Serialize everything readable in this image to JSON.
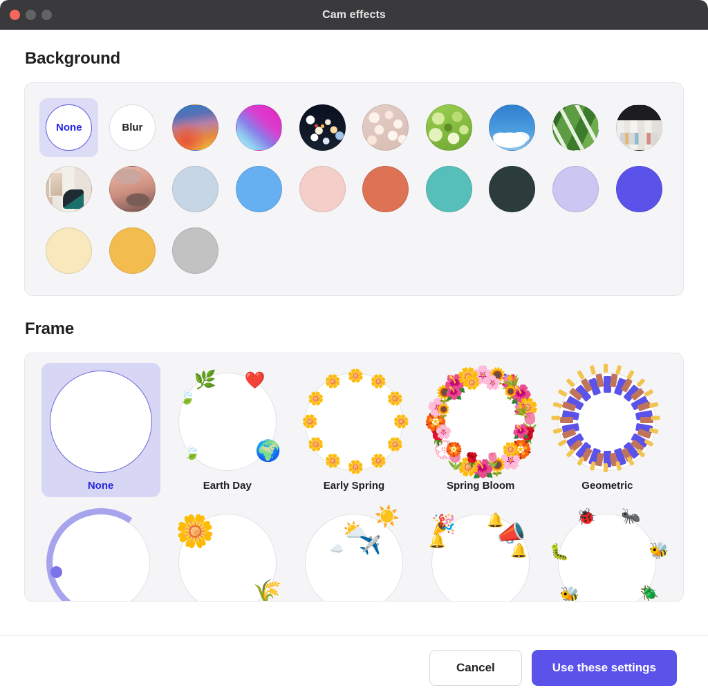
{
  "window": {
    "title": "Cam effects",
    "controls": [
      {
        "name": "close",
        "color": "#f4675a"
      },
      {
        "name": "minimize",
        "color": "#636366"
      },
      {
        "name": "maximize",
        "color": "#636366"
      }
    ]
  },
  "background": {
    "section_title": "Background",
    "selected": "None",
    "options": [
      {
        "label": "None",
        "type": "text",
        "style": "none-sw",
        "selected": true
      },
      {
        "label": "Blur",
        "type": "text",
        "style": "blur-sw",
        "selected": false
      },
      {
        "label": "",
        "type": "image",
        "style": "sw-gradient1",
        "desc": "blue-orange gradient",
        "selected": false
      },
      {
        "label": "",
        "type": "image",
        "style": "sw-gradient2",
        "desc": "magenta-blue gradient",
        "selected": false
      },
      {
        "label": "",
        "type": "image",
        "style": "sw-bokeh-dark",
        "desc": "dark night bokeh",
        "selected": false
      },
      {
        "label": "",
        "type": "image",
        "style": "sw-bokeh-pink",
        "desc": "pink bokeh",
        "selected": false
      },
      {
        "label": "",
        "type": "image",
        "style": "sw-bokeh-green",
        "desc": "green bokeh",
        "selected": false
      },
      {
        "label": "",
        "type": "image",
        "style": "sw-sky",
        "desc": "blue sky with clouds",
        "selected": false
      },
      {
        "label": "",
        "type": "image",
        "style": "sw-leaf",
        "desc": "green monstera leaves",
        "selected": false
      },
      {
        "label": "",
        "type": "image",
        "style": "sw-office",
        "desc": "modern office room",
        "selected": false
      },
      {
        "label": "",
        "type": "image",
        "style": "sw-living",
        "desc": "living room armchair",
        "selected": false
      },
      {
        "label": "",
        "type": "image",
        "style": "sw-sunset",
        "desc": "pink sunset clouds",
        "selected": false
      },
      {
        "label": "",
        "type": "color",
        "style": "sw-solid1",
        "color": "#c6d6e4",
        "selected": false
      },
      {
        "label": "",
        "type": "color",
        "style": "sw-solid2",
        "color": "#66b0f2",
        "selected": false
      },
      {
        "label": "",
        "type": "color",
        "style": "sw-solid3",
        "color": "#f4cfc9",
        "selected": false
      },
      {
        "label": "",
        "type": "color",
        "style": "sw-solid4",
        "color": "#dd7254",
        "selected": false
      },
      {
        "label": "",
        "type": "color",
        "style": "sw-solid5",
        "color": "#57bfb9",
        "selected": false
      },
      {
        "label": "",
        "type": "color",
        "style": "sw-solid6",
        "color": "#2c3c3c",
        "selected": false
      },
      {
        "label": "",
        "type": "color",
        "style": "sw-solid7",
        "color": "#cbc6f2",
        "selected": false
      },
      {
        "label": "",
        "type": "color",
        "style": "sw-solid8",
        "color": "#5b52ea",
        "selected": false
      },
      {
        "label": "",
        "type": "color",
        "style": "sw-solid9",
        "color": "#f9e8bd",
        "selected": false
      },
      {
        "label": "",
        "type": "color",
        "style": "sw-solid10",
        "color": "#f2bc4f",
        "selected": false
      },
      {
        "label": "",
        "type": "color",
        "style": "sw-solid11",
        "color": "#c2c2c2",
        "selected": false
      }
    ]
  },
  "frame": {
    "section_title": "Frame",
    "selected": "None",
    "options": [
      {
        "label": "None",
        "art": "none",
        "selected": true
      },
      {
        "label": "Earth Day",
        "art": "earthday",
        "selected": false
      },
      {
        "label": "Early Spring",
        "art": "earlyspring",
        "selected": false
      },
      {
        "label": "Spring Bloom",
        "art": "springbloom",
        "selected": false
      },
      {
        "label": "Geometric",
        "art": "geometric",
        "selected": false
      },
      {
        "label": "",
        "art": "arc",
        "selected": false
      },
      {
        "label": "",
        "art": "flower",
        "selected": false
      },
      {
        "label": "",
        "art": "weather",
        "selected": false
      },
      {
        "label": "",
        "art": "party",
        "selected": false
      },
      {
        "label": "",
        "art": "insects",
        "selected": false
      }
    ],
    "decor": {
      "earthday": [
        "🌿",
        "🍃",
        "❤️",
        "🌍",
        "🍃"
      ],
      "earlyspring": [
        "🌼",
        "🌼",
        "🌼",
        "🌼",
        "🌼",
        "🌼",
        "🌼",
        "🌼",
        "🌼",
        "🌼",
        "🌼",
        "🌼"
      ],
      "springbloom": [
        "🌸",
        "🌻",
        "💐",
        "🌺",
        "🌼",
        "🌷",
        "🌹",
        "🏵️",
        "🌸",
        "🌻",
        "🌺",
        "🌼",
        "🌷",
        "💮",
        "🌹",
        "🏵️",
        "🌸",
        "🌻",
        "🌺",
        "🌼"
      ],
      "arc": [
        "🔵",
        "🟣"
      ],
      "flower": [
        "🌼",
        "💮"
      ],
      "weather": [
        "☀️",
        "⛅",
        "✈️",
        "☁️"
      ],
      "party": [
        "🎉",
        "📣",
        "🔔",
        "🔔",
        "🔔"
      ],
      "insects": [
        "🐛",
        "🐞",
        "🐜",
        "🐝",
        "🪲",
        "🪰",
        "🐝"
      ]
    },
    "geometric_colors": [
      "#5b52ea",
      "#c0745c",
      "#f2c44f"
    ]
  },
  "footer": {
    "cancel_label": "Cancel",
    "confirm_label": "Use these settings",
    "confirm_color": "#5b52ea"
  }
}
